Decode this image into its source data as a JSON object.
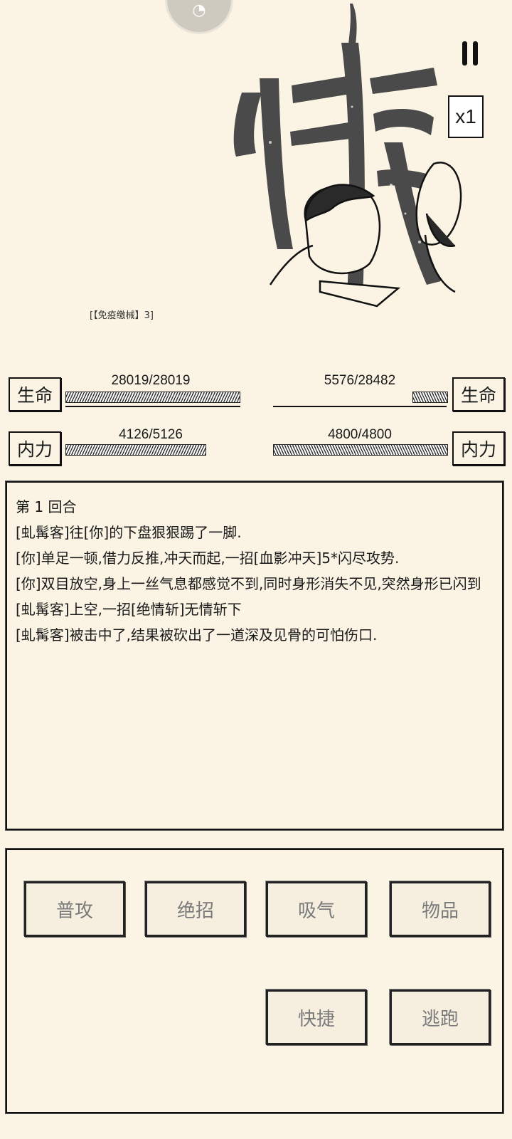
{
  "hud": {
    "speed_label": "x1"
  },
  "buff": {
    "text": "[【免疫缴械】3]"
  },
  "player": {
    "hp_label": "生命",
    "hp_value": "28019/28019",
    "hp_fraction": 1.0,
    "mp_label": "内力",
    "mp_value": "4126/5126",
    "mp_fraction": 0.805
  },
  "enemy": {
    "hp_label": "生命",
    "hp_value": "5576/28482",
    "hp_fraction": 0.196,
    "mp_label": "内力",
    "mp_value": "4800/4800",
    "mp_fraction": 1.0
  },
  "log": {
    "lines": [
      "第 1 回合",
      "[虬髯客]往[你]的下盘狠狠踢了一脚.",
      "[你]单足一顿,借力反推,冲天而起,一招[血影冲天]5*闪尽攻势.",
      "[你]双目放空,身上一丝气息都感觉不到,同时身形消失不见,突然身形已闪到[虬髯客]上空,一招[绝情斩]无情斩下",
      "[虬髯客]被击中了,结果被砍出了一道深及见骨的可怕伤口."
    ]
  },
  "actions": {
    "attack": "普攻",
    "ultimate": "绝招",
    "breathe": "吸气",
    "items": "物品",
    "quick": "快捷",
    "flee": "逃跑"
  }
}
